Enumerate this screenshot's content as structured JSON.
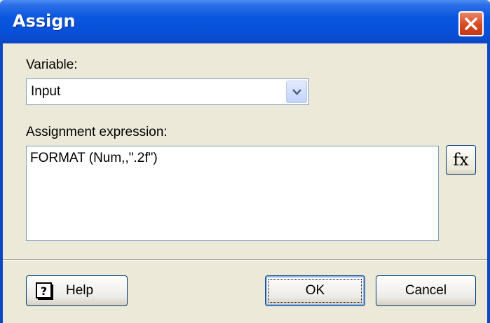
{
  "window": {
    "title": "Assign"
  },
  "variable": {
    "label": "Variable:",
    "selected": "Input"
  },
  "expression": {
    "label": "Assignment expression:",
    "value": "FORMAT (Num,,\".2f\")",
    "fx_label": "fx"
  },
  "buttons": {
    "help": "Help",
    "ok": "OK",
    "cancel": "Cancel"
  },
  "icons": {
    "close": "close-icon",
    "dropdown": "chevron-down-icon",
    "help": "help-book-icon"
  },
  "colors": {
    "titlebar": "#0a56e0",
    "close_button": "#d8491f",
    "dialog_background": "#ece9d8",
    "field_border": "#7f9db9"
  }
}
